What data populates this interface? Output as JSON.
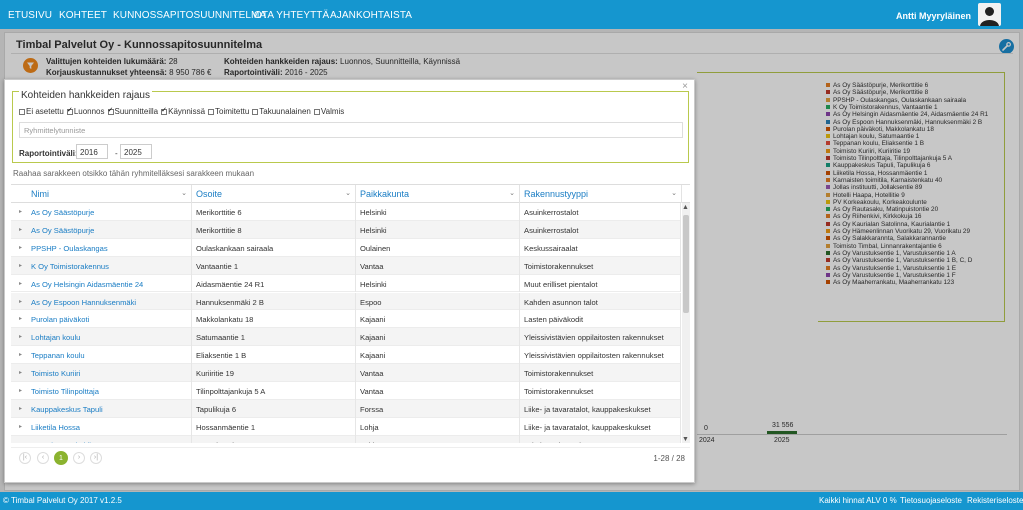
{
  "nav": {
    "items": [
      "ETUSIVU",
      "KOHTEET",
      "KUNNOSSAPITOSUUNNITELMA",
      "OTA YHTEYTTÄ",
      "AJANKOHTAISTA"
    ],
    "user": "Antti Myyryläinen"
  },
  "page": {
    "title": "Timbal Palvelut Oy - Kunnossapitosuunnitelma",
    "count_label": "Valittujen kohteiden lukumäärä:",
    "count_value": "28",
    "costs_label": "Korjauskustannukset yhteensä:",
    "costs_value": "8 950 786 €",
    "scope_label": "Kohteiden hankkeiden rajaus:",
    "scope_value": "Luonnos, Suunnitteilla, Käynnissä",
    "period_label": "Raportointiväli:",
    "period_value": "2016 - 2025"
  },
  "legend": {
    "items": [
      {
        "label": "As Oy Säästöpurje, Merikorttitie 6",
        "color": "#e67e22"
      },
      {
        "label": "As Oy Säästöpurje, Merikorttitie 8",
        "color": "#c0392b"
      },
      {
        "label": "PPSHP - Oulaskangas, Oulaskankaan sairaala",
        "color": "#e6a23c"
      },
      {
        "label": "K Oy Toimistorakennus, Vantaantie 1",
        "color": "#27ae60"
      },
      {
        "label": "As Oy Helsingin Aidasmäentie 24, Aidasmäentie 24 R1",
        "color": "#8e44ad"
      },
      {
        "label": "As Oy Espoon Hannuksenmäki, Hannuksenmäki 2 B",
        "color": "#2980b9"
      },
      {
        "label": "Purolan päiväkoti, Makkolankatu 18",
        "color": "#d35400"
      },
      {
        "label": "Lohtajan koulu, Satumaantie 1",
        "color": "#f1c40f"
      },
      {
        "label": "Teppanan koulu, Eliaksentie 1 B",
        "color": "#e74c3c"
      },
      {
        "label": "Toimisto Kuriiri, Kuriiritie 19",
        "color": "#f39c12"
      },
      {
        "label": "Toimisto Tilinpolttaja, Tilinpolttajankuja 5 A",
        "color": "#c0392b"
      },
      {
        "label": "Kauppakeskus Tapuli, Tapulikuja 6",
        "color": "#16a085"
      },
      {
        "label": "Liiketila Hossa, Hossanmäentie 1",
        "color": "#d35400"
      },
      {
        "label": "Karnaisten toimitila, Karnaistenkatu 40",
        "color": "#e67e22"
      },
      {
        "label": "Jollas instituutti, Jollaksentie 89",
        "color": "#9b59b6"
      },
      {
        "label": "Hotelli Haapa, Hotellitie 9",
        "color": "#e6a23c"
      },
      {
        "label": "PV Korkeakoulu, Korkeakoulunte",
        "color": "#f1c40f"
      },
      {
        "label": "As Oy Rautasaku, Matinpuistontie 20",
        "color": "#27ae60"
      },
      {
        "label": "As Oy Riihenkivi, Kirkkokuja 16",
        "color": "#e67e22"
      },
      {
        "label": "As Oy Kaurialan Satolinna, Kaurialantie 1",
        "color": "#c0392b"
      },
      {
        "label": "As Oy Hämeenlinnan Vuorikatu 29, Vuorikatu 29",
        "color": "#f39c12"
      },
      {
        "label": "As Oy Salakkarannta, Salakkarannantie",
        "color": "#d35400"
      },
      {
        "label": "Toimisto Timbal, Linnanrakentajantie 6",
        "color": "#e6a23c"
      },
      {
        "label": "As Oy Varustuksentie 1, Varustuksentie 1 A",
        "color": "#2c6f2c"
      },
      {
        "label": "As Oy Varustuksentie 1, Varustuksentie 1 B, C, D",
        "color": "#c0392b"
      },
      {
        "label": "As Oy Varustuksentie 1, Varustuksentie 1 E",
        "color": "#e67e22"
      },
      {
        "label": "As Oy Varustuksentie 1, Varustuksentie 1 F",
        "color": "#8e44ad"
      },
      {
        "label": "As Oy Maaherrankatu, Maaherrankatu 123",
        "color": "#d35400"
      }
    ]
  },
  "chart": {
    "val_2024": "0",
    "val_2025": "31 556",
    "year_2024": "2024",
    "year_2025": "2025"
  },
  "modal": {
    "close": "×",
    "filter_title": "Kohteiden hankkeiden rajaus",
    "checkboxes": [
      {
        "label": "Ei asetettu",
        "checked": false
      },
      {
        "label": "Luonnos",
        "checked": true
      },
      {
        "label": "Suunnitteilla",
        "checked": true
      },
      {
        "label": "Käynnissä",
        "checked": true
      },
      {
        "label": "Toimitettu",
        "checked": false
      },
      {
        "label": "Takuunalainen",
        "checked": false
      },
      {
        "label": "Valmis",
        "checked": false
      }
    ],
    "group_placeholder": "Ryhmittelytunniste",
    "period_label": "Raportointiväli:",
    "period_from": "2016",
    "period_dash": "-",
    "period_to": "2025",
    "drag_hint": "Raahaa sarakkeen otsikko tähän ryhmitelläksesi sarakkeen mukaan"
  },
  "table": {
    "headers": [
      "Nimi",
      "Osoite",
      "Paikkakunta",
      "Rakennustyyppi"
    ],
    "rows": [
      [
        "As Oy Säästöpurje",
        "Merikorttitie 6",
        "Helsinki",
        "Asuinkerrostalot"
      ],
      [
        "As Oy Säästöpurje",
        "Merikorttitie 8",
        "Helsinki",
        "Asuinkerrostalot"
      ],
      [
        "PPSHP - Oulaskangas",
        "Oulaskankaan sairaala",
        "Oulainen",
        "Keskussairaalat"
      ],
      [
        "K Oy Toimistorakennus",
        "Vantaantie 1",
        "Vantaa",
        "Toimistorakennukset"
      ],
      [
        "As Oy Helsingin Aidasmäentie 24",
        "Aidasmäentie 24 R1",
        "Helsinki",
        "Muut erilliset pientalot"
      ],
      [
        "As Oy Espoon Hannuksenmäki",
        "Hannuksenmäki 2 B",
        "Espoo",
        "Kahden asunnon talot"
      ],
      [
        "Purolan päiväkoti",
        "Makkolankatu 18",
        "Kajaani",
        "Lasten päiväkodit"
      ],
      [
        "Lohtajan koulu",
        "Satumaantie 1",
        "Kajaani",
        "Yleissivistävien oppilaitosten rakennukset"
      ],
      [
        "Teppanan koulu",
        "Eliaksentie 1 B",
        "Kajaani",
        "Yleissivistävien oppilaitosten rakennukset"
      ],
      [
        "Toimisto Kuriiri",
        "Kuriiritie 19",
        "Vantaa",
        "Toimistorakennukset"
      ],
      [
        "Toimisto Tilinpolttaja",
        "Tilinpolttajankuja 5 A",
        "Vantaa",
        "Toimistorakennukset"
      ],
      [
        "Kauppakeskus Tapuli",
        "Tapulikuja 6",
        "Forssa",
        "Liike- ja tavaratalot, kauppakeskukset"
      ],
      [
        "Liiketila Hossa",
        "Hossanmäentie 1",
        "Lohja",
        "Liike- ja tavaratalot, kauppakeskukset"
      ],
      [
        "Karnaisten toimitila",
        "Karnaistenkatu 40",
        "Lohja",
        "Toimistorakennukset"
      ]
    ]
  },
  "pager": {
    "first": "|‹",
    "prev": "‹",
    "page": "1",
    "next": "›",
    "last": "›|",
    "info": "1-28 / 28"
  },
  "footer": {
    "copyright": "© Timbal Palvelut Oy 2017 v1.2.5",
    "vat": "Kaikki hinnat ALV 0 %",
    "privacy": "Tietosuojaseloste",
    "register": "Rekisteriseloste"
  }
}
